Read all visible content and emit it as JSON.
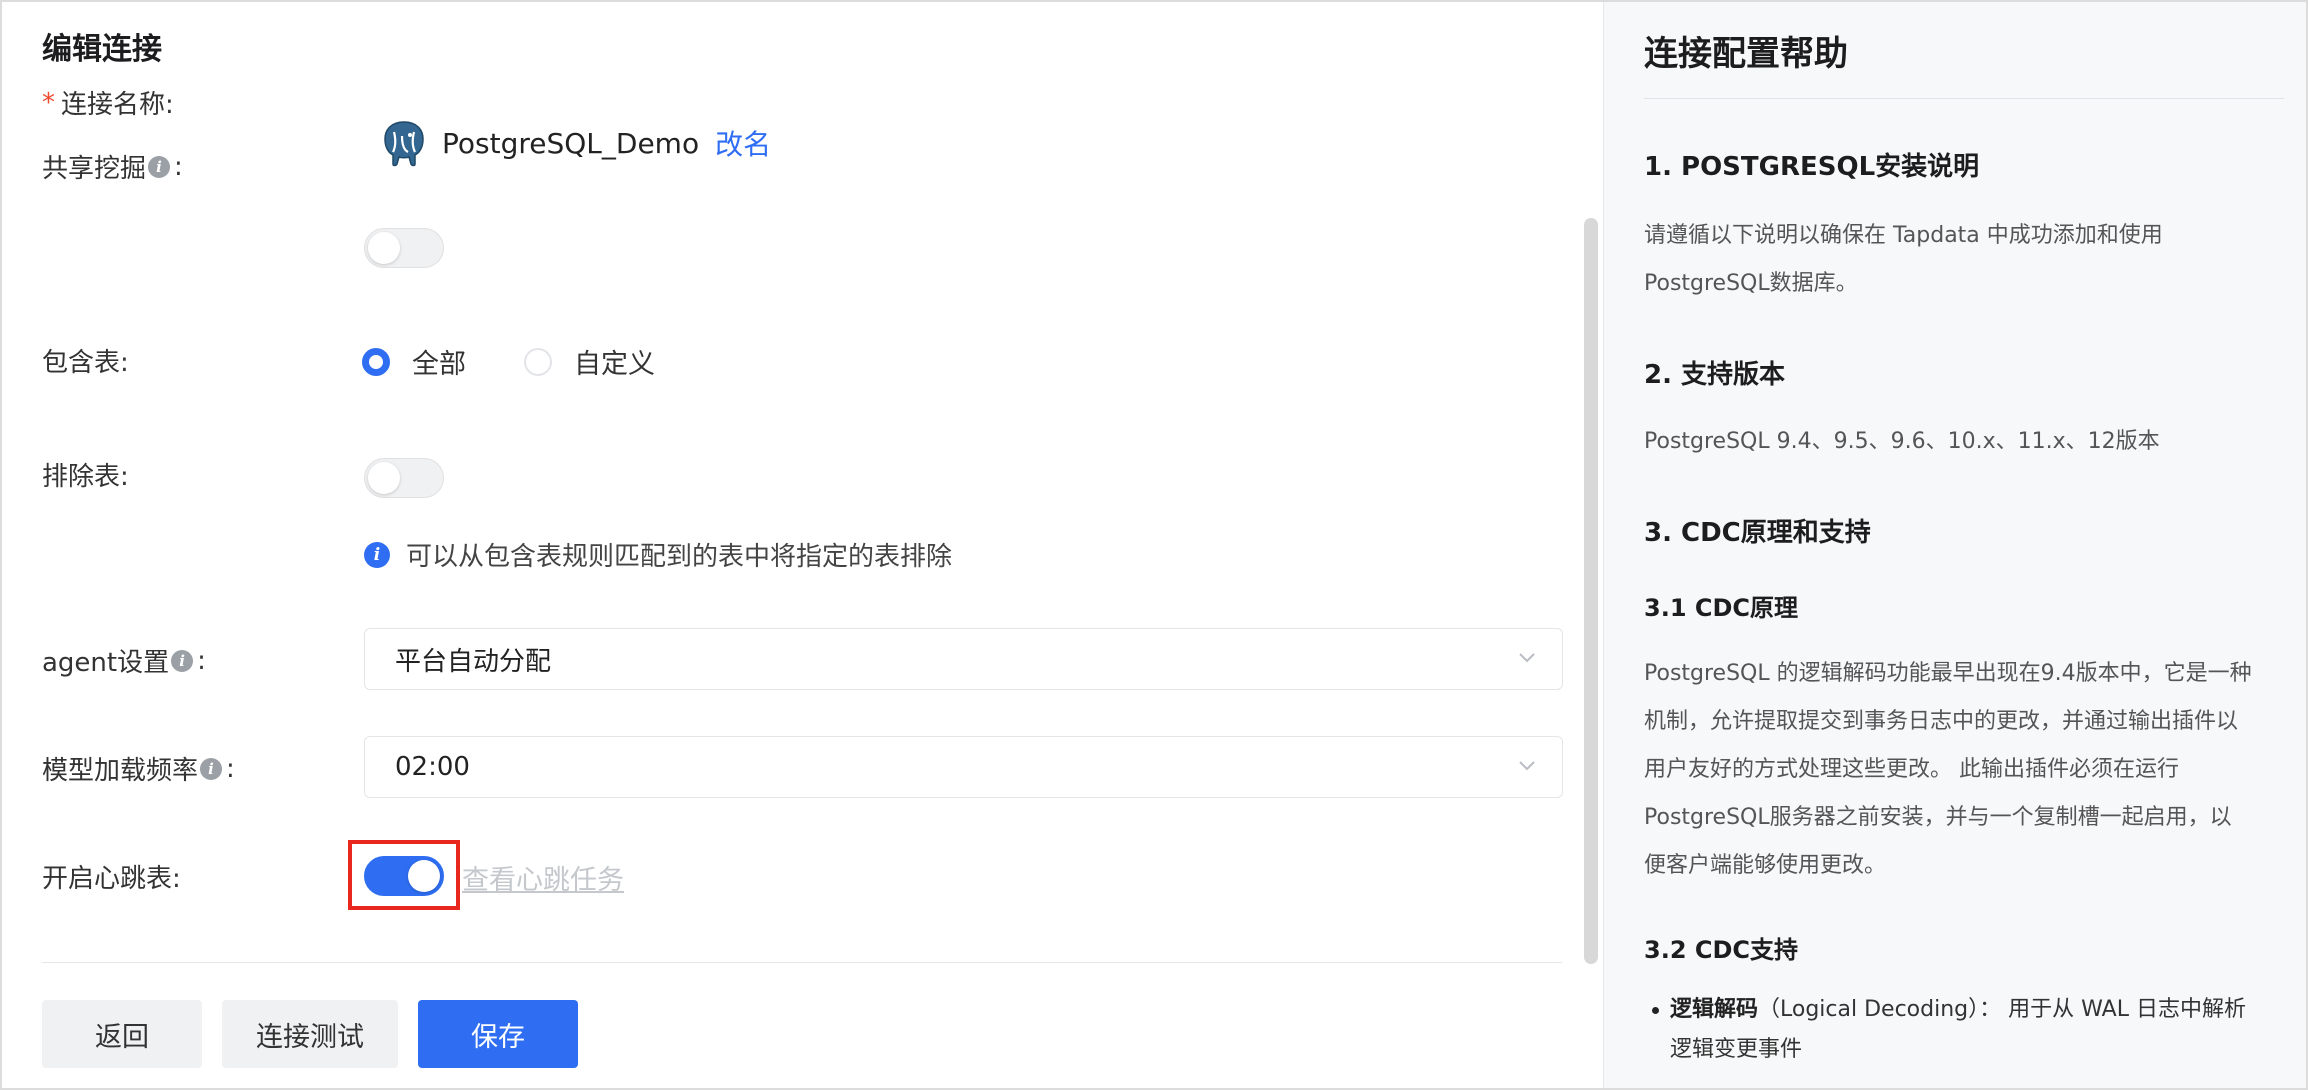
{
  "edit_panel": {
    "title": "编辑连接",
    "connection_name": {
      "label": "连接名称:",
      "required_mark": "*",
      "value": "PostgreSQL_Demo",
      "rename_label": "改名",
      "logo_icon": "postgresql-elephant-icon"
    },
    "shared_mining": {
      "label": "共享挖掘",
      "label_suffix": ":",
      "enabled": false
    },
    "include_tables": {
      "label": "包含表:",
      "options": [
        {
          "label": "全部",
          "checked": true
        },
        {
          "label": "自定义",
          "checked": false
        }
      ]
    },
    "exclude_tables": {
      "label": "排除表:",
      "enabled": false,
      "hint": "可以从包含表规则匹配到的表中将指定的表排除"
    },
    "agent_setting": {
      "label": "agent设置",
      "label_suffix": ":",
      "value": "平台自动分配"
    },
    "model_load_frequency": {
      "label": "模型加载频率",
      "label_suffix": ":",
      "value": "02:00"
    },
    "heartbeat_table": {
      "label": "开启心跳表:",
      "enabled": true,
      "view_task_link": "查看心跳任务"
    },
    "buttons": {
      "back": "返回",
      "test": "连接测试",
      "save": "保存"
    }
  },
  "help_panel": {
    "title": "连接配置帮助",
    "section1_title": "1. POSTGRESQL安装说明",
    "section1_line1": "请遵循以下说明以确保在 Tapdata 中成功添加和使用",
    "section1_line2": "PostgreSQL数据库。",
    "section2_title": "2. 支持版本",
    "section2_text": "PostgreSQL 9.4、9.5、9.6、10.x、11.x、12版本",
    "section3_title": "3. CDC原理和支持",
    "section31_title": "3.1 CDC原理",
    "section31_lines": [
      "PostgreSQL 的逻辑解码功能最早出现在9.4版本中，它是一种",
      "机制，允许提取提交到事务日志中的更改，并通过输出插件以",
      "用户友好的方式处理这些更改。 此输出插件必须在运行",
      "PostgreSQL服务器之前安装，并与一个复制槽一起启用，以",
      "便客户端能够使用更改。"
    ],
    "section32_title": "3.2 CDC支持",
    "bullet_bold": "逻辑解码",
    "bullet_rest_line1": "（Logical Decoding）： 用于从 WAL 日志中解析",
    "bullet_line2": "逻辑变更事件"
  },
  "colors": {
    "primary": "#2f6ef2",
    "required": "#f04b2f",
    "highlight_box": "#e8281e"
  }
}
